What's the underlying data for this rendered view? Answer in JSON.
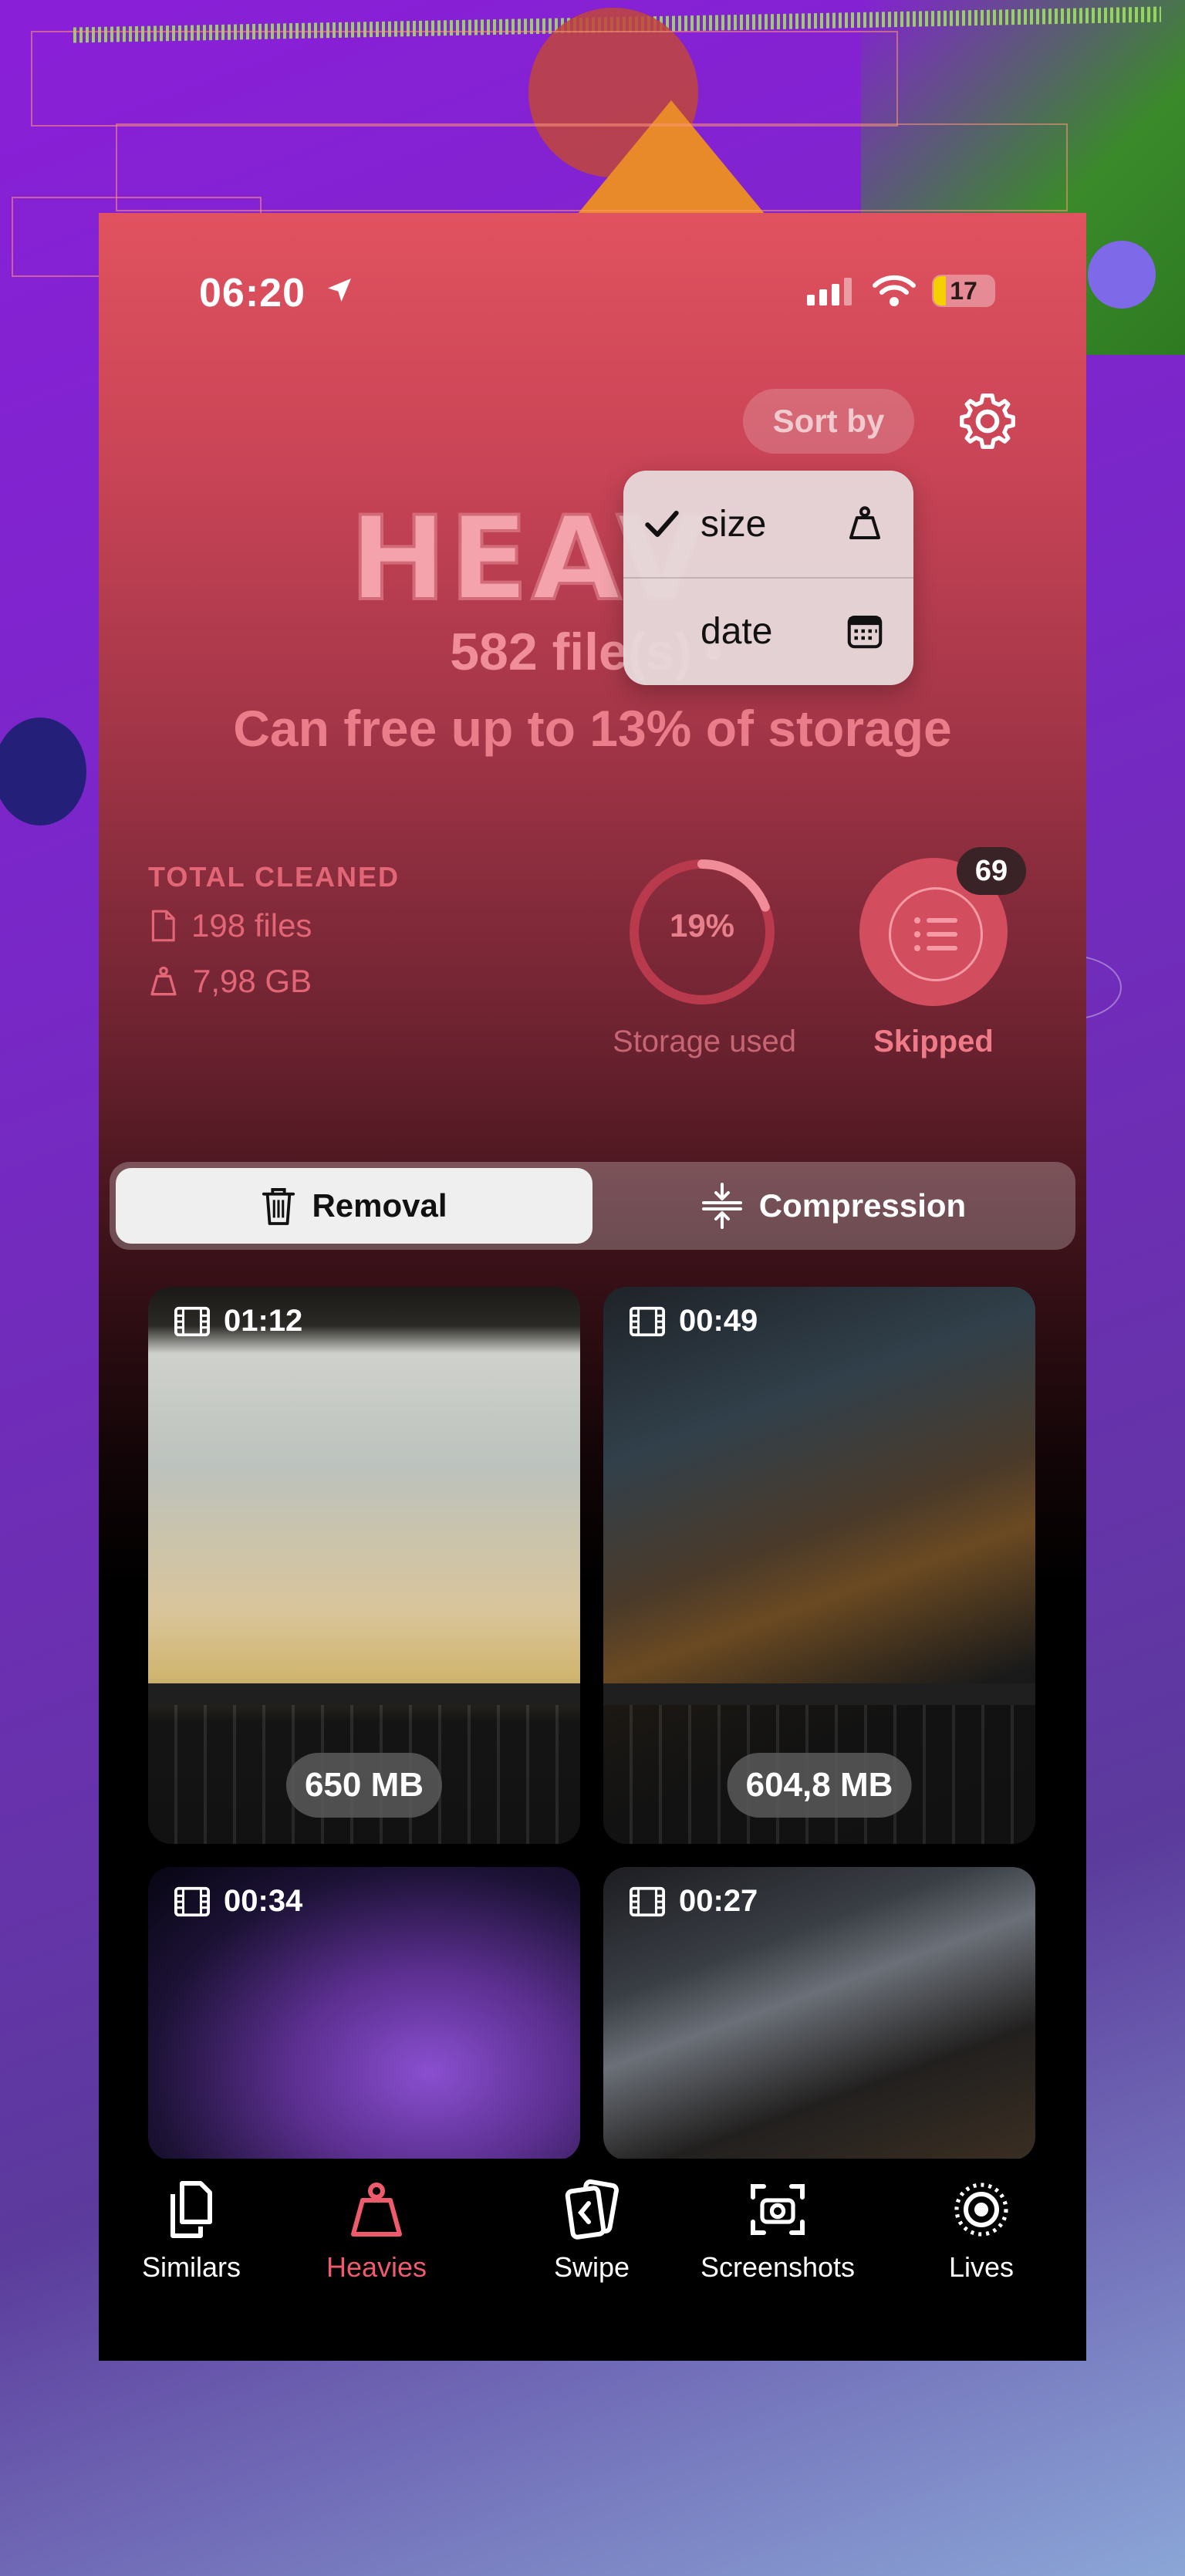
{
  "status_bar": {
    "time": "06:20",
    "battery": "17"
  },
  "header": {
    "sort_by_label": "Sort by",
    "title": "HEAV",
    "files_count": "582 file(s)",
    "separator": "•",
    "free_up_text": "Can free up to 13% of storage"
  },
  "sort_menu": {
    "items": [
      {
        "label": "size",
        "checked": true,
        "icon": "weight-icon"
      },
      {
        "label": "date",
        "checked": false,
        "icon": "calendar-icon"
      }
    ]
  },
  "stats": {
    "total_cleaned_label": "TOTAL CLEANED",
    "files": "198 files",
    "size": "7,98 GB",
    "storage_used_value": "19%",
    "storage_used_fraction": 0.19,
    "storage_used_label": "Storage used",
    "skipped_count": "69",
    "skipped_label": "Skipped"
  },
  "segmented": {
    "removal_label": "Removal",
    "compression_label": "Compression",
    "selected": "Removal"
  },
  "videos": [
    {
      "duration": "01:12",
      "size": "650 MB"
    },
    {
      "duration": "00:49",
      "size": "604,8 MB"
    },
    {
      "duration": "00:34",
      "size": ""
    },
    {
      "duration": "00:27",
      "size": ""
    }
  ],
  "tabbar": {
    "items": [
      {
        "label": "Similars",
        "icon": "documents-icon",
        "active": false
      },
      {
        "label": "Heavies",
        "icon": "weight-icon",
        "active": true
      },
      {
        "label": "Swipe",
        "icon": "swipe-cards-icon",
        "active": false
      },
      {
        "label": "Screenshots",
        "icon": "screenshot-icon",
        "active": false
      },
      {
        "label": "Lives",
        "icon": "live-photo-icon",
        "active": false
      }
    ]
  },
  "colors": {
    "accent": "#ee5b6d",
    "header_top": "#e1525f"
  }
}
